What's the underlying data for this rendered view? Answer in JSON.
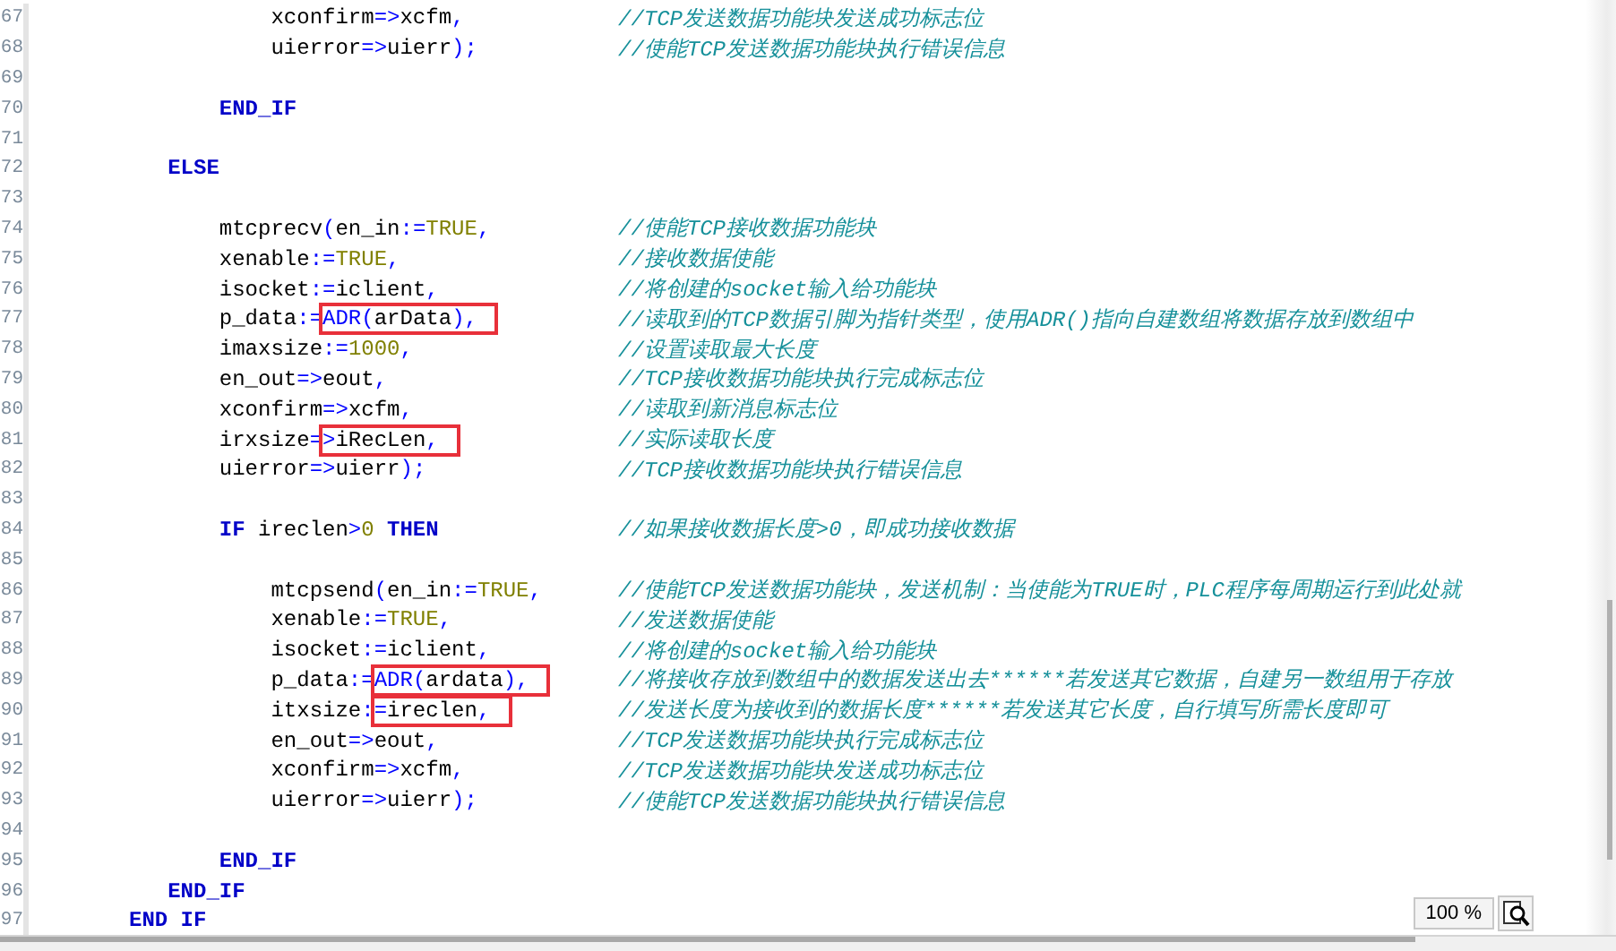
{
  "editor": {
    "lines": [
      {
        "number": "67",
        "tokens": [
          {
            "text": "           xconfirm",
            "kind": "ident"
          },
          {
            "text": "=>",
            "kind": "op"
          },
          {
            "text": "xcfm",
            "kind": "ident"
          },
          {
            "text": ",",
            "kind": "op"
          }
        ],
        "comment": "//TCP发送数据功能块发送成功标志位"
      },
      {
        "number": "68",
        "tokens": [
          {
            "text": "           uierror",
            "kind": "ident"
          },
          {
            "text": "=>",
            "kind": "op"
          },
          {
            "text": "uierr",
            "kind": "ident"
          },
          {
            "text": ");",
            "kind": "op"
          }
        ],
        "comment": "//使能TCP发送数据功能块执行错误信息"
      },
      {
        "number": "69"
      },
      {
        "number": "70",
        "tokens": [
          {
            "text": "       END_IF",
            "kind": "keyword"
          }
        ]
      },
      {
        "number": "71"
      },
      {
        "number": "72",
        "tokens": [
          {
            "text": "   ELSE",
            "kind": "keyword"
          }
        ]
      },
      {
        "number": "73"
      },
      {
        "number": "74",
        "tokens": [
          {
            "text": "       mtcprecv",
            "kind": "ident"
          },
          {
            "text": "(",
            "kind": "op"
          },
          {
            "text": "en_in",
            "kind": "ident"
          },
          {
            "text": ":=",
            "kind": "op"
          },
          {
            "text": "TRUE",
            "kind": "literal"
          },
          {
            "text": ",",
            "kind": "op"
          }
        ],
        "comment": "//使能TCP接收数据功能块"
      },
      {
        "number": "75",
        "tokens": [
          {
            "text": "       xenable",
            "kind": "ident"
          },
          {
            "text": ":=",
            "kind": "op"
          },
          {
            "text": "TRUE",
            "kind": "literal"
          },
          {
            "text": ",",
            "kind": "op"
          }
        ],
        "comment": "//接收数据使能"
      },
      {
        "number": "76",
        "tokens": [
          {
            "text": "       isocket",
            "kind": "ident"
          },
          {
            "text": ":=",
            "kind": "op"
          },
          {
            "text": "iclient",
            "kind": "ident"
          },
          {
            "text": ",",
            "kind": "op"
          }
        ],
        "comment": "//将创建的socket输入给功能块"
      },
      {
        "number": "77",
        "tokens": [
          {
            "text": "       p_data",
            "kind": "ident"
          },
          {
            "text": ":=",
            "kind": "op"
          }
        ],
        "marked": [
          {
            "text": "ADR",
            "kind": "op"
          },
          {
            "text": "(",
            "kind": "op"
          },
          {
            "text": "arData",
            "kind": "ident"
          },
          {
            "text": "),",
            "kind": "op"
          }
        ],
        "comment": "//读取到的TCP数据引脚为指针类型，使用ADR()指向自建数组将数据存放到数组中"
      },
      {
        "number": "78",
        "tokens": [
          {
            "text": "       imaxsize",
            "kind": "ident"
          },
          {
            "text": ":=",
            "kind": "op"
          },
          {
            "text": "1000",
            "kind": "literal"
          },
          {
            "text": ",",
            "kind": "op"
          }
        ],
        "comment": "//设置读取最大长度"
      },
      {
        "number": "79",
        "tokens": [
          {
            "text": "       en_out",
            "kind": "ident"
          },
          {
            "text": "=>",
            "kind": "op"
          },
          {
            "text": "eout",
            "kind": "ident"
          },
          {
            "text": ",",
            "kind": "op"
          }
        ],
        "comment": "//TCP接收数据功能块执行完成标志位"
      },
      {
        "number": "80",
        "tokens": [
          {
            "text": "       xconfirm",
            "kind": "ident"
          },
          {
            "text": "=>",
            "kind": "op"
          },
          {
            "text": "xcfm",
            "kind": "ident"
          },
          {
            "text": ",",
            "kind": "op"
          }
        ],
        "comment": "//读取到新消息标志位"
      },
      {
        "number": "81",
        "tokens": [
          {
            "text": "       irxsize",
            "kind": "ident"
          },
          {
            "text": "=",
            "kind": "op"
          }
        ],
        "marked": [
          {
            "text": ">",
            "kind": "op"
          },
          {
            "text": "iRecLen",
            "kind": "ident"
          },
          {
            "text": ",",
            "kind": "op"
          }
        ],
        "comment": "//实际读取长度"
      },
      {
        "number": "82",
        "tokens": [
          {
            "text": "       uierror",
            "kind": "ident"
          },
          {
            "text": "=>",
            "kind": "op"
          },
          {
            "text": "uierr",
            "kind": "ident"
          },
          {
            "text": ");",
            "kind": "op"
          }
        ],
        "comment": "//TCP接收数据功能块执行错误信息"
      },
      {
        "number": "83"
      },
      {
        "number": "84",
        "tokens": [
          {
            "text": "       IF",
            "kind": "keyword"
          },
          {
            "text": " ireclen",
            "kind": "ident"
          },
          {
            "text": ">",
            "kind": "op"
          },
          {
            "text": "0",
            "kind": "literal"
          },
          {
            "text": " THEN",
            "kind": "keyword"
          }
        ],
        "comment": "//如果接收数据长度>0，即成功接收数据"
      },
      {
        "number": "85"
      },
      {
        "number": "86",
        "tokens": [
          {
            "text": "           mtcpsend",
            "kind": "ident"
          },
          {
            "text": "(",
            "kind": "op"
          },
          {
            "text": "en_in",
            "kind": "ident"
          },
          {
            "text": ":=",
            "kind": "op"
          },
          {
            "text": "TRUE",
            "kind": "literal"
          },
          {
            "text": ",",
            "kind": "op"
          }
        ],
        "comment": "//使能TCP发送数据功能块，发送机制：当使能为TRUE时，PLC程序每周期运行到此处就"
      },
      {
        "number": "87",
        "tokens": [
          {
            "text": "           xenable",
            "kind": "ident"
          },
          {
            "text": ":=",
            "kind": "op"
          },
          {
            "text": "TRUE",
            "kind": "literal"
          },
          {
            "text": ",",
            "kind": "op"
          }
        ],
        "comment": "//发送数据使能"
      },
      {
        "number": "88",
        "tokens": [
          {
            "text": "           isocket",
            "kind": "ident"
          },
          {
            "text": ":=",
            "kind": "op"
          },
          {
            "text": "iclient",
            "kind": "ident"
          },
          {
            "text": ",",
            "kind": "op"
          }
        ],
        "comment": "//将创建的socket输入给功能块"
      },
      {
        "number": "89",
        "tokens": [
          {
            "text": "           p_data",
            "kind": "ident"
          },
          {
            "text": ":=",
            "kind": "op"
          }
        ],
        "marked": [
          {
            "text": "ADR",
            "kind": "op"
          },
          {
            "text": "(",
            "kind": "op"
          },
          {
            "text": "ardata",
            "kind": "ident"
          },
          {
            "text": "),",
            "kind": "op"
          }
        ],
        "comment": "//将接收存放到数组中的数据发送出去******若发送其它数据，自建另一数组用于存放"
      },
      {
        "number": "90",
        "tokens": [
          {
            "text": "           itxsize",
            "kind": "ident"
          },
          {
            "text": ":",
            "kind": "op"
          }
        ],
        "marked": [
          {
            "text": "=",
            "kind": "op"
          },
          {
            "text": "ireclen",
            "kind": "ident"
          },
          {
            "text": ",",
            "kind": "op"
          }
        ],
        "comment": "//发送长度为接收到的数据长度******若发送其它长度，自行填写所需长度即可"
      },
      {
        "number": "91",
        "tokens": [
          {
            "text": "           en_out",
            "kind": "ident"
          },
          {
            "text": "=>",
            "kind": "op"
          },
          {
            "text": "eout",
            "kind": "ident"
          },
          {
            "text": ",",
            "kind": "op"
          }
        ],
        "comment": "//TCP发送数据功能块执行完成标志位"
      },
      {
        "number": "92",
        "tokens": [
          {
            "text": "           xconfirm",
            "kind": "ident"
          },
          {
            "text": "=>",
            "kind": "op"
          },
          {
            "text": "xcfm",
            "kind": "ident"
          },
          {
            "text": ",",
            "kind": "op"
          }
        ],
        "comment": "//TCP发送数据功能块发送成功标志位"
      },
      {
        "number": "93",
        "tokens": [
          {
            "text": "           uierror",
            "kind": "ident"
          },
          {
            "text": "=>",
            "kind": "op"
          },
          {
            "text": "uierr",
            "kind": "ident"
          },
          {
            "text": ");",
            "kind": "op"
          }
        ],
        "comment": "//使能TCP发送数据功能块执行错误信息"
      },
      {
        "number": "94"
      },
      {
        "number": "95",
        "tokens": [
          {
            "text": "       END_IF",
            "kind": "keyword"
          }
        ]
      },
      {
        "number": "96",
        "tokens": [
          {
            "text": "   END_IF",
            "kind": "keyword"
          }
        ]
      },
      {
        "number": "97",
        "tokens": [
          {
            "text": "END IF",
            "kind": "keyword"
          }
        ]
      }
    ]
  },
  "zoom": {
    "value": "100 %"
  }
}
